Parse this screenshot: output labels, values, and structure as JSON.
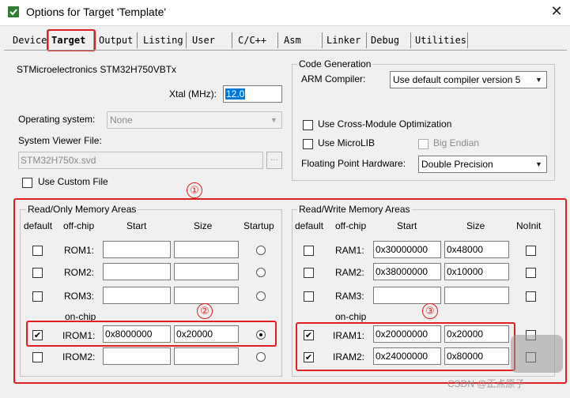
{
  "window": {
    "title": "Options for Target 'Template'",
    "close_symbol": "✕"
  },
  "tabs": [
    "Device",
    "Target",
    "Output",
    "Listing",
    "User",
    "C/C++",
    "Asm",
    "Linker",
    "Debug",
    "Utilities"
  ],
  "device": {
    "name": "STMicroelectronics STM32H750VBTx"
  },
  "xtal": {
    "label": "Xtal (MHz):",
    "value": "12.0"
  },
  "os": {
    "label": "Operating system:",
    "value": "None"
  },
  "svd": {
    "label": "System Viewer File:",
    "value": "STM32H750x.svd",
    "browse": "..."
  },
  "custom_file": {
    "label": "Use Custom File",
    "checked": false
  },
  "codegen": {
    "title": "Code Generation",
    "arm_compiler_label": "ARM Compiler:",
    "arm_compiler_value": "Use default compiler version 5",
    "cross_module": "Use Cross-Module Optimization",
    "microlib": "Use MicroLIB",
    "big_endian": "Big Endian",
    "fpu_label": "Floating Point Hardware:",
    "fpu_value": "Double Precision"
  },
  "ro": {
    "title": "Read/Only Memory Areas",
    "headers": {
      "default": "default",
      "offchip": "off-chip",
      "start": "Start",
      "size": "Size",
      "startup": "Startup"
    },
    "onchip_label": "on-chip",
    "rows": [
      {
        "name": "ROM1:",
        "start": "",
        "size": "",
        "checked": false,
        "startup": false
      },
      {
        "name": "ROM2:",
        "start": "",
        "size": "",
        "checked": false,
        "startup": false
      },
      {
        "name": "ROM3:",
        "start": "",
        "size": "",
        "checked": false,
        "startup": false
      },
      {
        "name": "IROM1:",
        "start": "0x8000000",
        "size": "0x20000",
        "checked": true,
        "startup": true
      },
      {
        "name": "IROM2:",
        "start": "",
        "size": "",
        "checked": false,
        "startup": false
      }
    ]
  },
  "rw": {
    "title": "Read/Write Memory Areas",
    "headers": {
      "default": "default",
      "offchip": "off-chip",
      "start": "Start",
      "size": "Size",
      "noinit": "NoInit"
    },
    "onchip_label": "on-chip",
    "rows": [
      {
        "name": "RAM1:",
        "start": "0x30000000",
        "size": "0x48000",
        "checked": false
      },
      {
        "name": "RAM2:",
        "start": "0x38000000",
        "size": "0x10000",
        "checked": false
      },
      {
        "name": "RAM3:",
        "start": "",
        "size": "",
        "checked": false
      },
      {
        "name": "IRAM1:",
        "start": "0x20000000",
        "size": "0x20000",
        "checked": true
      },
      {
        "name": "IRAM2:",
        "start": "0x24000000",
        "size": "0x80000",
        "checked": true
      }
    ]
  },
  "annotations": {
    "one": "①",
    "two": "②",
    "three": "③"
  },
  "watermark": "CSDN @正点原子",
  "colors": {
    "annotation": "#e02020",
    "selection": "#0078d7"
  }
}
